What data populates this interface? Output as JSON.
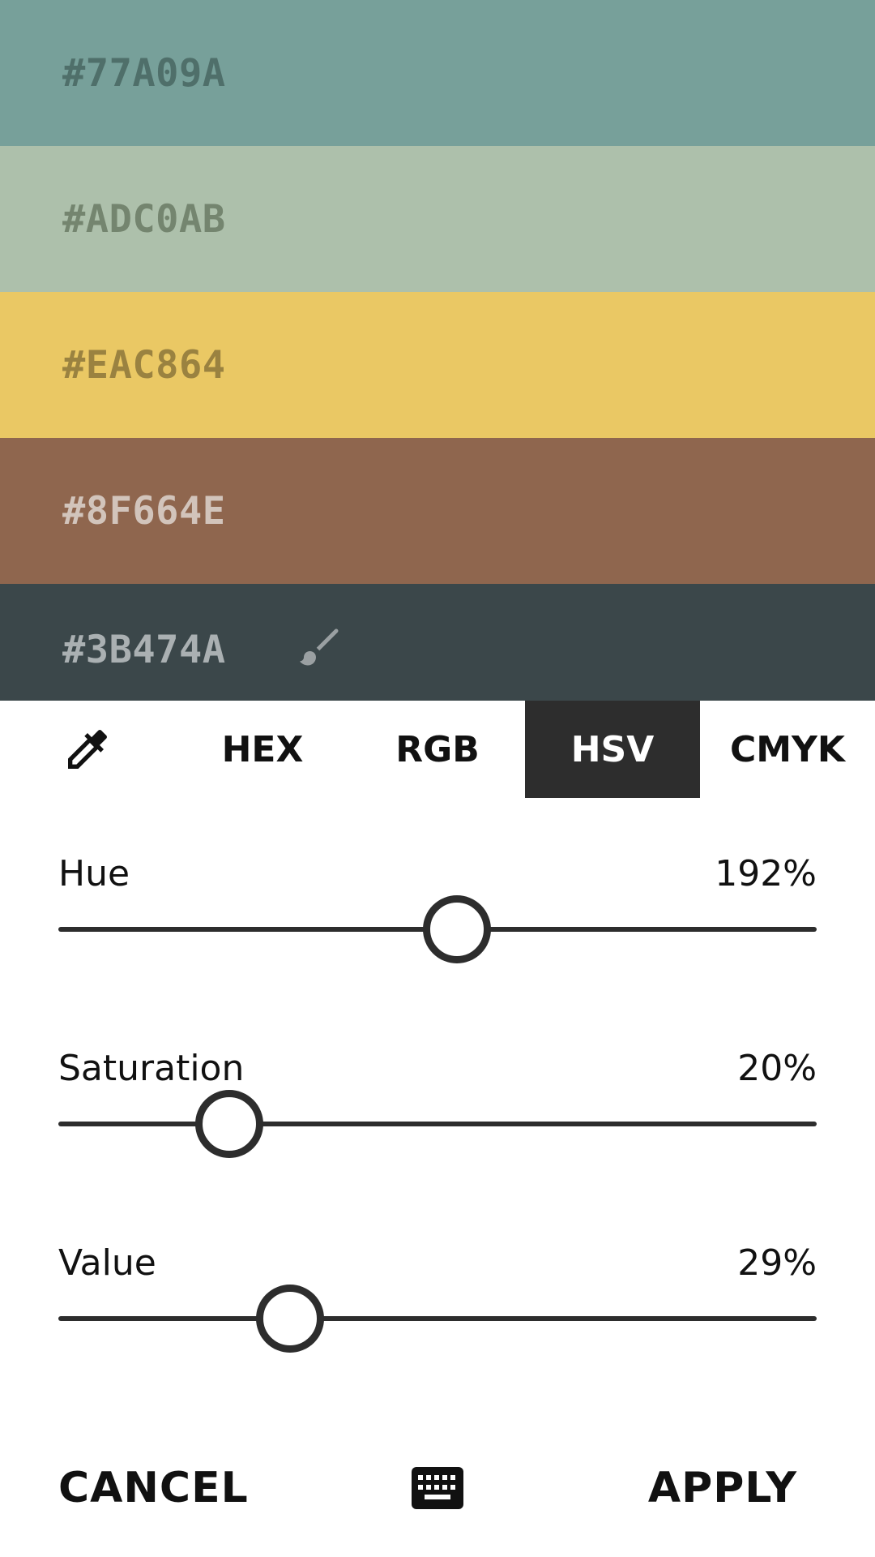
{
  "palette": [
    {
      "hex_label": "#77A09A",
      "color": "#77A09A",
      "text_color": "#4f6f6a"
    },
    {
      "hex_label": "#ADC0AB",
      "color": "#ADC0AB",
      "text_color": "#74856f"
    },
    {
      "hex_label": "#EAC864",
      "color": "#EAC864",
      "text_color": "#9a8240"
    },
    {
      "hex_label": "#8F664E",
      "color": "#8F664E",
      "text_color": "#d2c4bb"
    },
    {
      "hex_label": "#3B474A",
      "color": "#3B474A",
      "text_color": "#aab0b2",
      "icon": "paint-brush-icon"
    }
  ],
  "tabs": {
    "picker_icon": "eyedropper-icon",
    "items": [
      {
        "label": "HEX",
        "active": false
      },
      {
        "label": "RGB",
        "active": false
      },
      {
        "label": "HSV",
        "active": true
      },
      {
        "label": "CMYK",
        "active": false
      }
    ]
  },
  "sliders": [
    {
      "label": "Hue",
      "value_text": "192%",
      "fraction": 0.526
    },
    {
      "label": "Saturation",
      "value_text": "20%",
      "fraction": 0.225
    },
    {
      "label": "Value",
      "value_text": "29%",
      "fraction": 0.306
    }
  ],
  "actions": {
    "cancel_label": "CANCEL",
    "apply_label": "APPLY",
    "keyboard_icon": "keyboard-icon"
  },
  "colors": {
    "accent_dark": "#2D2D2D",
    "background": "#FFFFFF"
  }
}
